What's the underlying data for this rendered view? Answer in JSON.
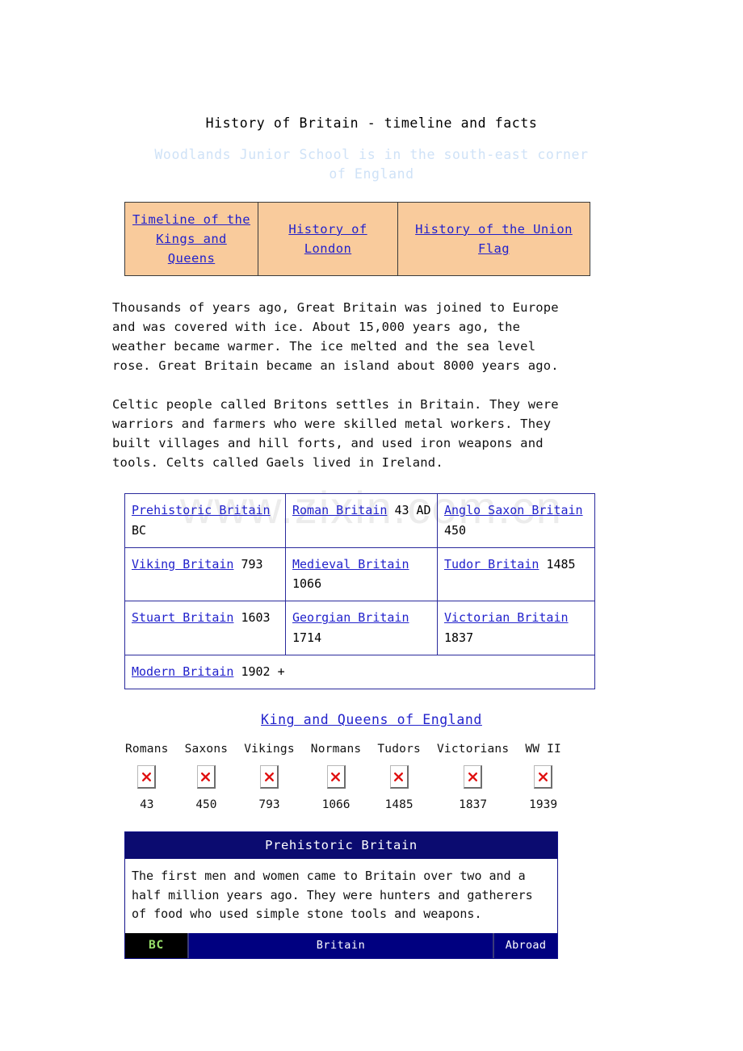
{
  "document": {
    "title": "History of Britain - timeline and facts",
    "subtitle": "Woodlands Junior School is in the south-east corner of England",
    "watermark": "www.zixin.com.cn"
  },
  "nav": {
    "links": [
      {
        "label": "Timeline of the Kings and Queens"
      },
      {
        "label": "History of London "
      },
      {
        "label": "History of the Union Flag"
      }
    ]
  },
  "paragraphs": {
    "p1": "Thousands of years ago, Great Britain was joined to Europe and was covered with ice. About 15,000 years ago, the weather became warmer. The ice melted and the sea level rose. Great Britain became an island about 8000 years ago.",
    "p2": "Celtic people called Britons settles in Britain. They were warriors and farmers who were skilled metal workers. They built villages and hill forts, and used iron weapons and tools. Celts called Gaels lived in Ireland."
  },
  "periods": {
    "rows": [
      [
        {
          "link": "Prehistoric Britain",
          "date": "BC"
        },
        {
          "link": "Roman Britain",
          "date": "43 AD"
        },
        {
          "link": "Anglo Saxon Britain",
          "date": "450"
        }
      ],
      [
        {
          "link": "Viking Britain",
          "date": "793"
        },
        {
          "link": "Medieval Britain",
          "date": "1066"
        },
        {
          "link": "Tudor Britain",
          "date": "1485"
        }
      ],
      [
        {
          "link": "Stuart Britain",
          "date": "1603"
        },
        {
          "link": "Georgian Britain",
          "date": "1714"
        },
        {
          "link": "Victorian Britain",
          "date": "1837"
        }
      ]
    ],
    "last_row": {
      "link": "Modern Britain",
      "date": "1902 +"
    }
  },
  "kings_link": {
    "label": "King and Queens of England"
  },
  "era_strip": {
    "icon_name": "broken-image-icon",
    "items": [
      {
        "label": "Romans",
        "year": "43"
      },
      {
        "label": "Saxons",
        "year": "450"
      },
      {
        "label": "Vikings",
        "year": "793"
      },
      {
        "label": "Normans",
        "year": "1066"
      },
      {
        "label": "Tudors",
        "year": "1485"
      },
      {
        "label": "Victorians",
        "year": "1837"
      },
      {
        "label": "WW II",
        "year": "1939"
      }
    ]
  },
  "panel": {
    "header": "Prehistoric Britain",
    "body": "The first men and women came to Britain over two and a half million years ago. They were hunters and gatherers of food who used simple stone tools and weapons.",
    "footer": {
      "era": "BC",
      "middle": "Britain",
      "right": "Abroad"
    }
  },
  "colors": {
    "link": "#2222cc",
    "nav_background": "#f9cb9c",
    "panel_header": "#0b0b70",
    "panel_footer": "#000080",
    "era_text": "#99e06a",
    "subtitle": "#cfe2f7",
    "table_border": "#2a2a9c"
  }
}
